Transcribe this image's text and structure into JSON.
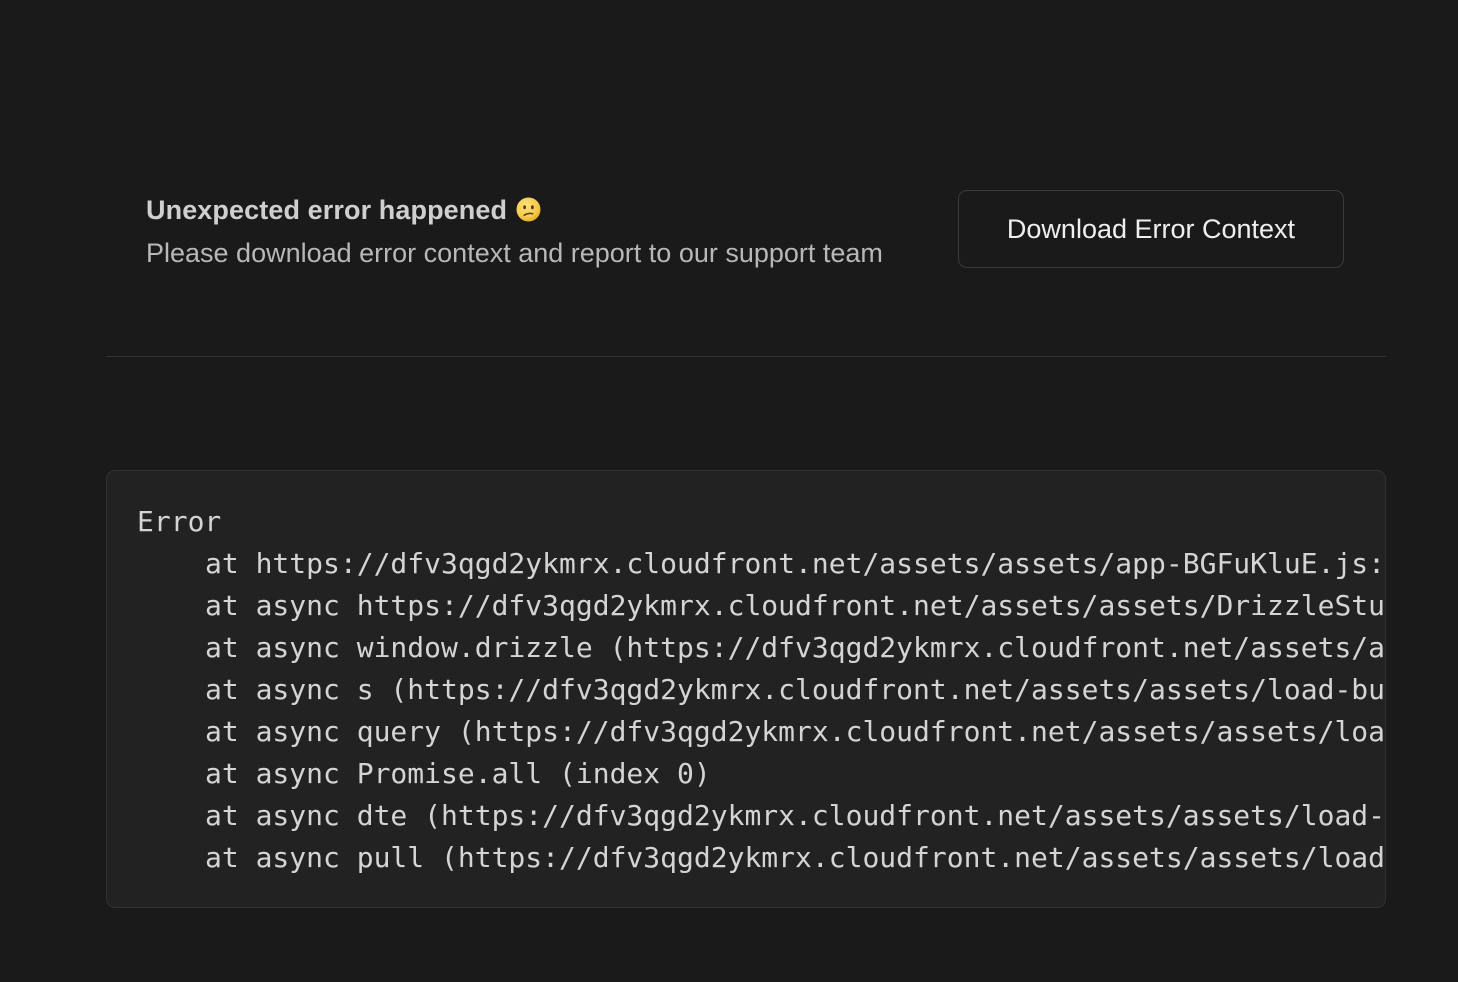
{
  "error_notice": {
    "title": "Unexpected error happened",
    "emoji_icon": "confused-face-icon",
    "description": "Please download error context and report to our support team",
    "download_button_label": "Download Error Context"
  },
  "stack_trace": {
    "error_name": "Error",
    "frames": [
      "at https://dfv3qgd2ykmrx.cloudfront.net/assets/assets/app-BGFuKluE.js:",
      "at async https://dfv3qgd2ykmrx.cloudfront.net/assets/assets/DrizzleStu",
      "at async window.drizzle (https://dfv3qgd2ykmrx.cloudfront.net/assets/a",
      "at async s (https://dfv3qgd2ykmrx.cloudfront.net/assets/assets/load-bu",
      "at async query (https://dfv3qgd2ykmrx.cloudfront.net/assets/assets/loa",
      "at async Promise.all (index 0)",
      "at async dte (https://dfv3qgd2ykmrx.cloudfront.net/assets/assets/load-",
      "at async pull (https://dfv3qgd2ykmrx.cloudfront.net/assets/assets/load"
    ]
  },
  "colors": {
    "background": "#1a1a1a",
    "panel_background": "#222222",
    "border": "#333333",
    "text_primary": "#cfcfcf",
    "text_secondary": "#b8b8b8",
    "emoji_yellow": "#f6c84a"
  }
}
